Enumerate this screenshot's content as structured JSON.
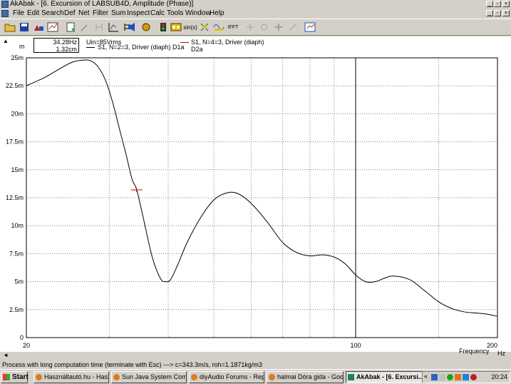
{
  "window": {
    "title": "AkAbak - [6. Excursion of LABSUB4D, Amplitude (Phase)]"
  },
  "menu": [
    "File",
    "Edit",
    "Search",
    "Def",
    "Net",
    "Filter",
    "Sum",
    "Inspect",
    "Calc",
    "Tools",
    "Window",
    "Help"
  ],
  "toolbar": {
    "sin_label": "sin(x)",
    "ifft_label": "IFFT"
  },
  "cursor": {
    "frequency": "34.28Hz",
    "value": "1.32cm"
  },
  "legend": {
    "uin": "Uin=85Vrms",
    "series1": "S1, N=2=3, Driver (diaph) D1a",
    "series2": "S1, N=4=3, Driver (diaph) D2a"
  },
  "colors": {
    "series1": "#000000",
    "series2": "#cc0000",
    "grid": "#808080"
  },
  "chart_data": {
    "type": "line",
    "xscale": "log",
    "xlim": [
      20,
      200
    ],
    "ylim": [
      0,
      25
    ],
    "y_unit": "m",
    "xlabel": "Frequency",
    "x_unit": "Hz",
    "x_ticks": [
      {
        "value": 20,
        "label": "20"
      },
      {
        "value": 100,
        "label": "100"
      },
      {
        "value": 200,
        "label": "200"
      }
    ],
    "y_ticks": [
      {
        "value": 0,
        "label": "0"
      },
      {
        "value": 2.5,
        "label": "2.5m"
      },
      {
        "value": 5,
        "label": "5m"
      },
      {
        "value": 7.5,
        "label": "7.5m"
      },
      {
        "value": 10,
        "label": "10m"
      },
      {
        "value": 12.5,
        "label": "12.5m"
      },
      {
        "value": 15,
        "label": "15m"
      },
      {
        "value": 17.5,
        "label": "17.5m"
      },
      {
        "value": 20,
        "label": "20m"
      },
      {
        "value": 22.5,
        "label": "22.5m"
      },
      {
        "value": 25,
        "label": "25m"
      }
    ],
    "x_minor": [
      30,
      40,
      50,
      60,
      70,
      80,
      90,
      150
    ],
    "marker": {
      "x": 34.28,
      "y": 13.2
    },
    "series": [
      {
        "name": "S1, N=2=3, Driver (diaph) D1a",
        "x": [
          20,
          21,
          22,
          23.5,
          25,
          26.5,
          27.5,
          28.5,
          29.5,
          30.5,
          31.5,
          32.5,
          33.5,
          34.3,
          35.5,
          37,
          38.5,
          39.5,
          40.5,
          42,
          44,
          47,
          50,
          53,
          56,
          60,
          65,
          70,
          75,
          80,
          85,
          90,
          95,
          100,
          105,
          110,
          115,
          120,
          130,
          140,
          150,
          160,
          170,
          180,
          190,
          200
        ],
        "y": [
          22.5,
          22.9,
          23.3,
          24.0,
          24.6,
          24.8,
          24.7,
          24.1,
          22.9,
          21.0,
          18.7,
          16.5,
          14.2,
          13.2,
          10.5,
          7.2,
          5.3,
          5.0,
          5.2,
          6.6,
          8.6,
          10.8,
          12.3,
          12.9,
          12.9,
          12.0,
          10.3,
          8.5,
          7.6,
          7.3,
          7.4,
          7.2,
          6.6,
          5.6,
          5.0,
          5.0,
          5.3,
          5.5,
          5.2,
          4.2,
          3.2,
          2.6,
          2.3,
          2.2,
          2.1,
          1.9
        ]
      }
    ]
  },
  "status": "Process with long computation time (terminate with Esc) ---> c=343.3m/s, roh=1.1871kg/m3",
  "taskbar": {
    "start": "Start",
    "tasks": [
      "Használtautó.hu - Hasz...",
      "Sun Java System Com...",
      "diyAudio Forums - Repl...",
      "halmai Dóra gida - Goog...",
      "AkAbak - [6. Excursi..."
    ],
    "clock": "20:24"
  }
}
